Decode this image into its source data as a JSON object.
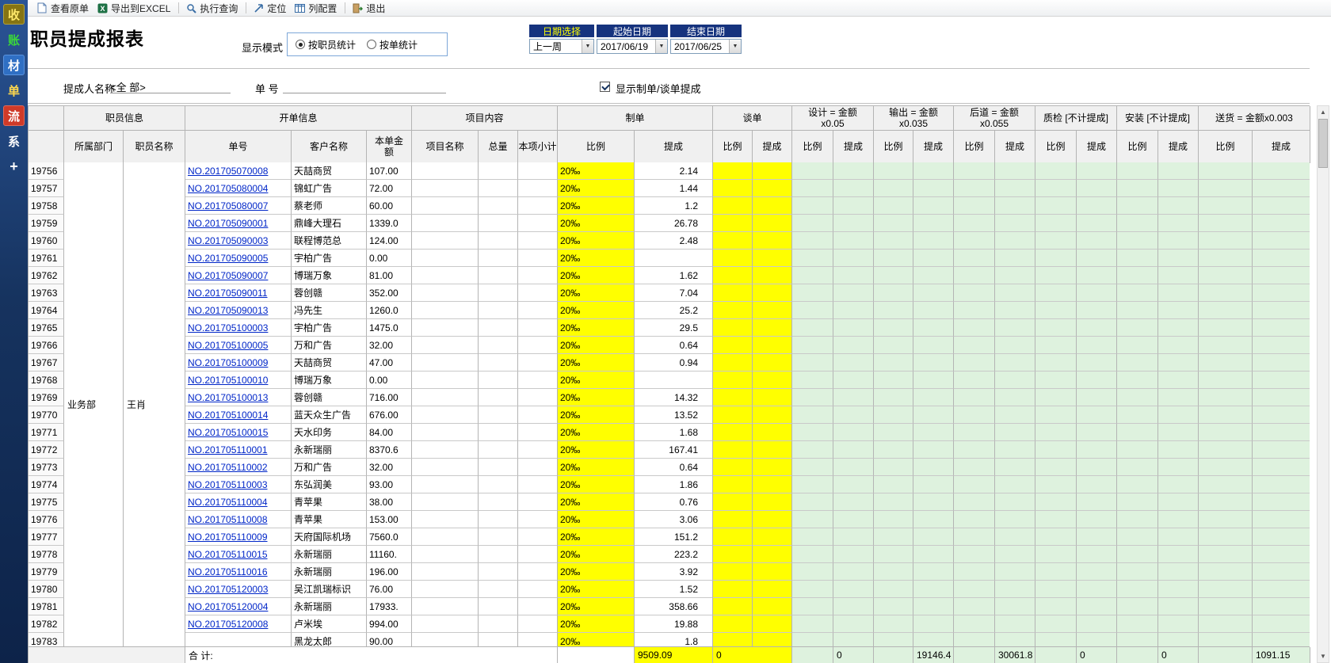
{
  "sidebar": {
    "items": [
      {
        "label": "收"
      },
      {
        "label": "账"
      },
      {
        "label": "材"
      },
      {
        "label": "单"
      },
      {
        "label": "流"
      },
      {
        "label": "系"
      },
      {
        "label": "+"
      }
    ]
  },
  "toolbar": {
    "buttons": [
      {
        "label": "查看原单"
      },
      {
        "label": "导出到EXCEL"
      },
      {
        "label": "执行查询"
      },
      {
        "label": "定位"
      },
      {
        "label": "列配置"
      },
      {
        "label": "退出"
      }
    ]
  },
  "header": {
    "title": "职员提成报表",
    "display_mode_label": "显示模式",
    "modes": [
      {
        "label": "按职员统计",
        "selected": true
      },
      {
        "label": "按单统计",
        "selected": false
      }
    ],
    "date_panel": {
      "headers": [
        "日期选择",
        "起始日期",
        "结束日期"
      ],
      "preset": "上一周",
      "start_date": "2017/06/19",
      "end_date": "2017/06/25"
    }
  },
  "filters": {
    "person_label": "提成人名称",
    "person_value": "<全 部>",
    "order_label": "单  号",
    "order_value": "",
    "show_commission_label": "显示制单/谈单提成",
    "show_commission_checked": true
  },
  "table": {
    "groups": [
      {
        "l1": "职员信息"
      },
      {
        "l1": "开单信息"
      },
      {
        "l1": "项目内容"
      },
      {
        "l1": "制单"
      },
      {
        "l1": "谈单"
      },
      {
        "l1": "设计 = 金额",
        "l2": "x0.05"
      },
      {
        "l1": "输出 = 金额",
        "l2": "x0.035"
      },
      {
        "l1": "后道 = 金额",
        "l2": "x0.055"
      },
      {
        "l1": "质检 [不计提成]"
      },
      {
        "l1": "安装 [不计提成]"
      },
      {
        "l1": "送货 = 金额x0.003"
      }
    ],
    "sub": {
      "dept": "所属部门",
      "name": "职员名称",
      "order": "单号",
      "customer": "客户名称",
      "amount": "本单金额",
      "project": "项目名称",
      "qty": "总量",
      "subtotal": "本项小计",
      "ratio": "比例",
      "commission": "提成"
    },
    "employee": {
      "department": "业务部",
      "name": "王肖"
    },
    "row_columns": [
      "row_no",
      "order_no",
      "customer",
      "amount",
      "make_ratio",
      "make_commission"
    ],
    "rows": [
      [
        "19756",
        "NO.201705070008",
        "天喆商贸",
        "107.00",
        "20‰",
        "2.14"
      ],
      [
        "19757",
        "NO.201705080004",
        "锦虹广告",
        "72.00",
        "20‰",
        "1.44"
      ],
      [
        "19758",
        "NO.201705080007",
        "蔡老师",
        "60.00",
        "20‰",
        "1.2"
      ],
      [
        "19759",
        "NO.201705090001",
        "鼎峰大理石",
        "1339.0",
        "20‰",
        "26.78"
      ],
      [
        "19760",
        "NO.201705090003",
        "联程博范总",
        "124.00",
        "20‰",
        "2.48"
      ],
      [
        "19761",
        "NO.201705090005",
        "宇柏广告",
        "0.00",
        "20‰",
        ""
      ],
      [
        "19762",
        "NO.201705090007",
        "博瑞万象",
        "81.00",
        "20‰",
        "1.62"
      ],
      [
        "19763",
        "NO.201705090011",
        "蓉创赣",
        "352.00",
        "20‰",
        "7.04"
      ],
      [
        "19764",
        "NO.201705090013",
        "冯先生",
        "1260.0",
        "20‰",
        "25.2"
      ],
      [
        "19765",
        "NO.201705100003",
        "宇柏广告",
        "1475.0",
        "20‰",
        "29.5"
      ],
      [
        "19766",
        "NO.201705100005",
        "万和广告",
        "32.00",
        "20‰",
        "0.64"
      ],
      [
        "19767",
        "NO.201705100009",
        "天喆商贸",
        "47.00",
        "20‰",
        "0.94"
      ],
      [
        "19768",
        "NO.201705100010",
        "博瑞万象",
        "0.00",
        "20‰",
        ""
      ],
      [
        "19769",
        "NO.201705100013",
        "蓉创赣",
        "716.00",
        "20‰",
        "14.32"
      ],
      [
        "19770",
        "NO.201705100014",
        "蓝天众生广告",
        "676.00",
        "20‰",
        "13.52"
      ],
      [
        "19771",
        "NO.201705100015",
        "天水印务",
        "84.00",
        "20‰",
        "1.68"
      ],
      [
        "19772",
        "NO.201705110001",
        "永新瑞丽",
        "8370.6",
        "20‰",
        "167.41"
      ],
      [
        "19773",
        "NO.201705110002",
        "万和广告",
        "32.00",
        "20‰",
        "0.64"
      ],
      [
        "19774",
        "NO.201705110003",
        "东弘润美",
        "93.00",
        "20‰",
        "1.86"
      ],
      [
        "19775",
        "NO.201705110004",
        "青苹果",
        "38.00",
        "20‰",
        "0.76"
      ],
      [
        "19776",
        "NO.201705110008",
        "青苹果",
        "153.00",
        "20‰",
        "3.06"
      ],
      [
        "19777",
        "NO.201705110009",
        "天府国际机场",
        "7560.0",
        "20‰",
        "151.2"
      ],
      [
        "19778",
        "NO.201705110015",
        "永新瑞丽",
        "11160.",
        "20‰",
        "223.2"
      ],
      [
        "19779",
        "NO.201705110016",
        "永新瑞丽",
        "196.00",
        "20‰",
        "3.92"
      ],
      [
        "19780",
        "NO.201705120003",
        "吴江凯瑞标识",
        "76.00",
        "20‰",
        "1.52"
      ],
      [
        "19781",
        "NO.201705120004",
        "永新瑞丽",
        "17933.",
        "20‰",
        "358.66"
      ],
      [
        "19782",
        "NO.201705120008",
        "卢米埃",
        "994.00",
        "20‰",
        "19.88"
      ],
      [
        "19783",
        "",
        "黑龙太郎",
        "90.00",
        "20‰",
        "1.8"
      ]
    ],
    "totals": {
      "label": "合 计:",
      "make_commission": "9509.09",
      "negotiate_commission": "0",
      "design_commission": "0",
      "output_commission": "19146.4",
      "process_commission": "30061.8",
      "qc_commission": "0",
      "install_commission": "0",
      "delivery_commission": "1091.15"
    }
  }
}
